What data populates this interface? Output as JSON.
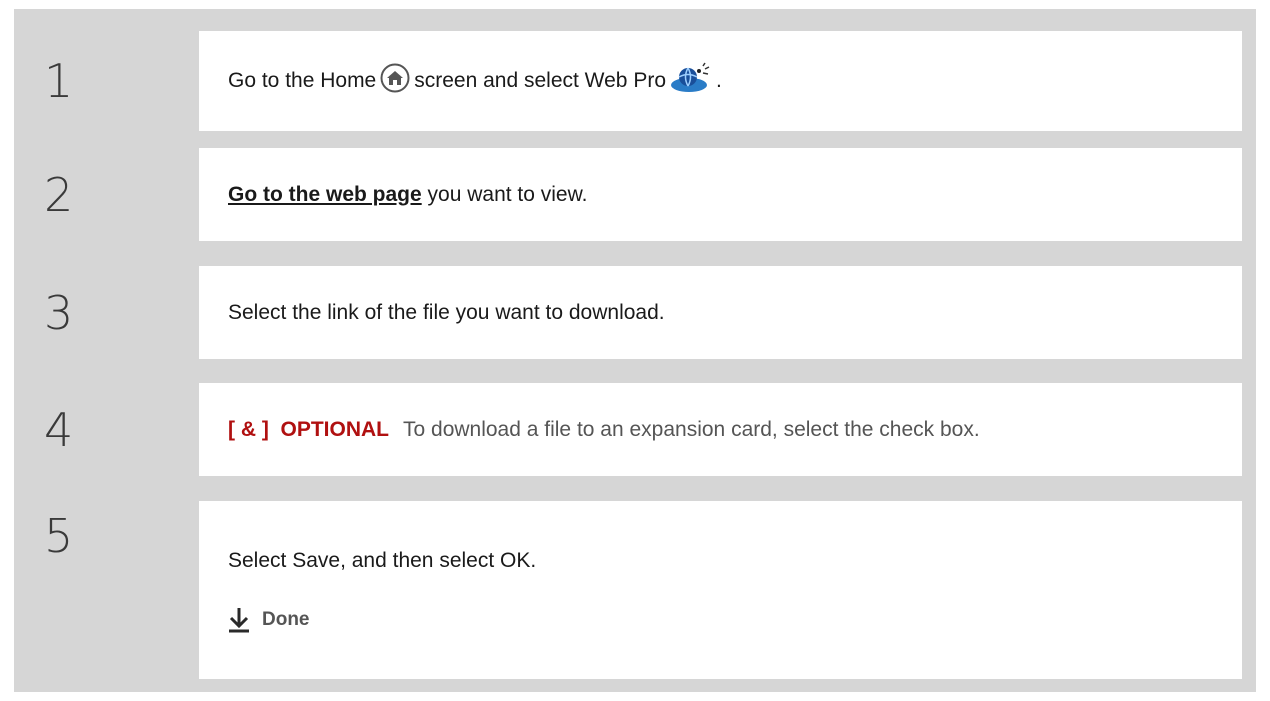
{
  "steps": [
    {
      "number": "1",
      "text_before": "Go to the Home",
      "text_middle": "screen and select Web Pro",
      "text_after": "."
    },
    {
      "number": "2",
      "link": "Go to the web page",
      "text": "you want to view."
    },
    {
      "number": "3",
      "text": "Select the link of the file you want to download."
    },
    {
      "number": "4",
      "tag": "[ & ]  OPTIONAL",
      "text": "To download a file to an expansion card, select the check box."
    },
    {
      "number": "5",
      "text": "Select Save, and then select OK.",
      "done_label": "Done"
    }
  ],
  "icons": {
    "home": "home-icon",
    "web_pro": "globe-icon",
    "done": "down-arrow-icon"
  },
  "colors": {
    "panel": "#d6d6d6",
    "optional": "#b01010"
  }
}
